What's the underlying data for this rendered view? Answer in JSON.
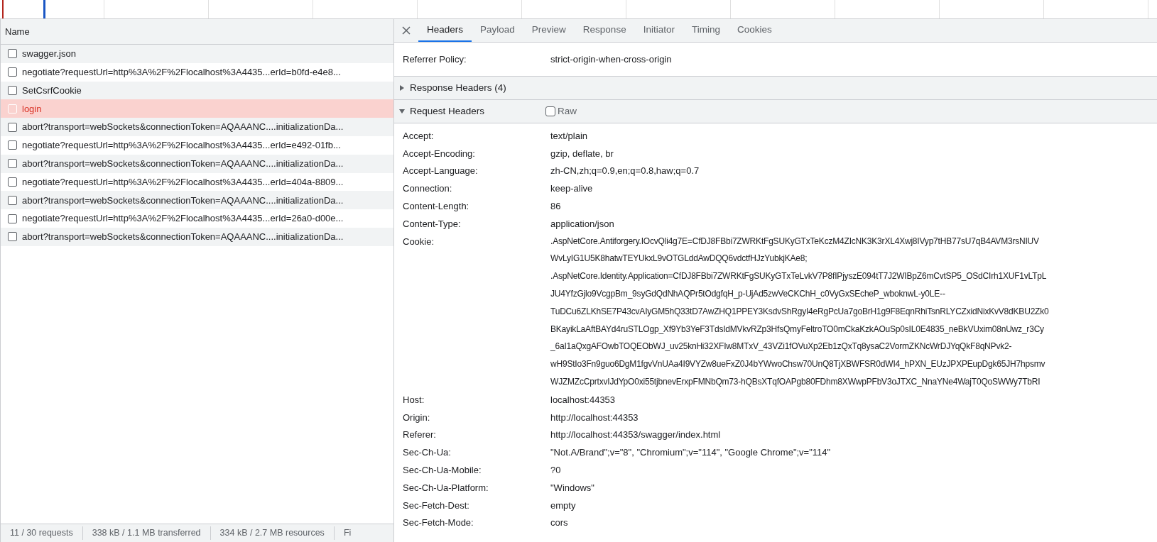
{
  "requests": {
    "column": "Name",
    "rows": [
      {
        "name": "swagger.json",
        "selected": false
      },
      {
        "name": "negotiate?requestUrl=http%3A%2F%2Flocalhost%3A4435...erId=b0fd-e4e8...",
        "selected": false
      },
      {
        "name": "SetCsrfCookie",
        "selected": false
      },
      {
        "name": "login",
        "selected": true
      },
      {
        "name": "abort?transport=webSockets&connectionToken=AQAAANC....initializationDa...",
        "selected": false
      },
      {
        "name": "negotiate?requestUrl=http%3A%2F%2Flocalhost%3A4435...erId=e492-01fb...",
        "selected": false
      },
      {
        "name": "abort?transport=webSockets&connectionToken=AQAAANC....initializationDa...",
        "selected": false
      },
      {
        "name": "negotiate?requestUrl=http%3A%2F%2Flocalhost%3A4435...erId=404a-8809...",
        "selected": false
      },
      {
        "name": "abort?transport=webSockets&connectionToken=AQAAANC....initializationDa...",
        "selected": false
      },
      {
        "name": "negotiate?requestUrl=http%3A%2F%2Flocalhost%3A4435...erId=26a0-d00e...",
        "selected": false
      },
      {
        "name": "abort?transport=webSockets&connectionToken=AQAAANC....initializationDa...",
        "selected": false
      }
    ]
  },
  "status_bar": [
    "11 / 30 requests",
    "338 kB / 1.1 MB transferred",
    "334 kB / 2.7 MB resources",
    "Fi"
  ],
  "tabs": [
    {
      "label": "Headers",
      "selected": true
    },
    {
      "label": "Payload",
      "selected": false
    },
    {
      "label": "Preview",
      "selected": false
    },
    {
      "label": "Response",
      "selected": false
    },
    {
      "label": "Initiator",
      "selected": false
    },
    {
      "label": "Timing",
      "selected": false
    },
    {
      "label": "Cookies",
      "selected": false
    }
  ],
  "general_tail": [
    {
      "name": "Referrer Policy:",
      "value": [
        "strict-origin-when-cross-origin"
      ]
    }
  ],
  "sections": [
    {
      "title": "Response Headers (4)",
      "expanded": false
    },
    {
      "title": "Request Headers",
      "expanded": true,
      "raw": {
        "label": "Raw",
        "checked": false
      },
      "headers": [
        {
          "name": "Accept:",
          "value": [
            "text/plain"
          ]
        },
        {
          "name": "Accept-Encoding:",
          "value": [
            "gzip, deflate, br"
          ]
        },
        {
          "name": "Accept-Language:",
          "value": [
            "zh-CN,zh;q=0.9,en;q=0.8,haw;q=0.7"
          ]
        },
        {
          "name": "Connection:",
          "value": [
            "keep-alive"
          ]
        },
        {
          "name": "Content-Length:",
          "value": [
            "86"
          ]
        },
        {
          "name": "Content-Type:",
          "value": [
            "application/json"
          ]
        },
        {
          "name": "Cookie:",
          "value": [
            ".AspNetCore.Antiforgery.IOcvQli4g7E=CfDJ8FBbi7ZWRKtFgSUKyGTxTeKczM4ZIcNK3K3rXL4Xwj8IVyp7tHB77sU7qB4AVM3rsNIUV",
            "WvLyIG1U5K8hatwTEYUkxL9vOTGLddAwDQQ6vdctfHJzYubkjKAe8;",
            ".AspNetCore.Identity.Application=CfDJ8FBbi7ZWRKtFgSUKyGTxTeLvkV7P8fIPjyszE094tT7J2WIBpZ6mCvtSP5_OSdCIrh1XUF1vLTpL",
            "JU4YfzGjlo9VcgpBm_9syGdQdNhAQPr5tOdgfqH_p-UjAd5zwVeCKChH_c0VyGxSEcheP_wboknwL-y0LE--",
            "TuDCu6ZLKhSE7P43cvAIyGM5hQ33tD7AwZHQ1PPEY3KsdvShRgyI4eRgPcUa7goBrH1g9F8EqnRhiTsnRLYCZxidNixKvV8dKBU2Zk0",
            "BKayikLaAftBAYd4ruSTLOgp_Xf9Yb3YeF3TdsIdMVkvRZp3HfsQmyFeltroTO0mCkaKzkAOuSp0sIL0E4835_neBkVUxim08nUwz_r3Cy",
            "_6aI1aQxgAFOwbTOQEObWJ_uv25knHi32XFIw8MTxV_43VZi1fOVuXp2Eb1zQxTq8ysaC2VormZKNcWrDJYqQkF8qNPvk2-",
            "wH9StIo3Fn9guo6DgM1fgvVnUAa4I9VYZw8ueFxZ0J4bYWwoChsw70UnQ8TjXBWFSR0dWI4_hPXN_EUzJPXPEupDgk65JH7hpsmv",
            "WJZMZcCprtxvIJdYpO0xi55tjbnevErxpFMNbQm73-hQBsXTqfOAPgb80FDhm8XWwpPFbV3oJTXC_NnaYNe4WajT0QoSWWy7TbRI"
          ]
        },
        {
          "name": "Host:",
          "value": [
            "localhost:44353"
          ]
        },
        {
          "name": "Origin:",
          "value": [
            "http://localhost:44353"
          ]
        },
        {
          "name": "Referer:",
          "value": [
            "http://localhost:44353/swagger/index.html"
          ]
        },
        {
          "name": "Sec-Ch-Ua:",
          "value": [
            "\"Not.A/Brand\";v=\"8\", \"Chromium\";v=\"114\", \"Google Chrome\";v=\"114\""
          ]
        },
        {
          "name": "Sec-Ch-Ua-Mobile:",
          "value": [
            "?0"
          ]
        },
        {
          "name": "Sec-Ch-Ua-Platform:",
          "value": [
            "\"Windows\""
          ]
        },
        {
          "name": "Sec-Fetch-Dest:",
          "value": [
            "empty"
          ]
        },
        {
          "name": "Sec-Fetch-Mode:",
          "value": [
            "cors"
          ]
        }
      ]
    }
  ]
}
